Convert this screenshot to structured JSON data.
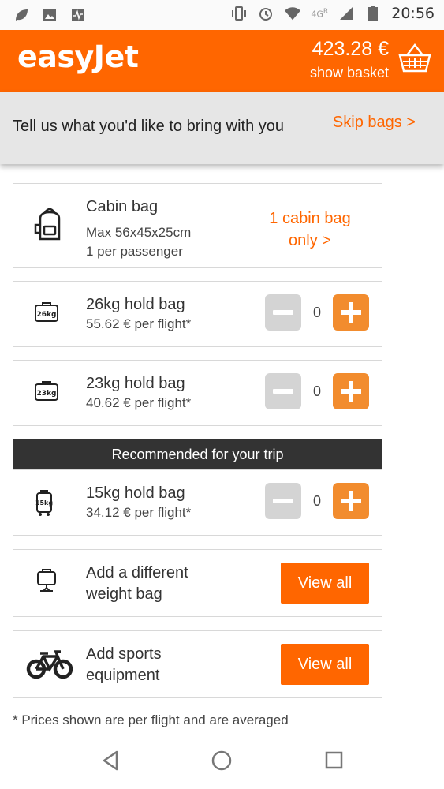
{
  "status_bar": {
    "network": "4G",
    "roaming": "R",
    "time": "20:56",
    "icons": [
      "leaf-icon",
      "image-icon",
      "activity-icon",
      "vibrate-icon",
      "alarm-icon",
      "wifi-icon",
      "signal-icon",
      "battery-icon"
    ]
  },
  "header": {
    "logo": "easyJet",
    "price": "423.28 €",
    "basket_label": "show basket",
    "brand_color": "#ff6600"
  },
  "subheader": {
    "title": "Tell us what you'd like to bring with you",
    "skip": "Skip bags >"
  },
  "cabin": {
    "title": "Cabin bag",
    "size": "Max 56x45x25cm",
    "limit": "1 per passenger",
    "link": "1 cabin bag only >"
  },
  "hold_bags": [
    {
      "title": "26kg hold bag",
      "price": "55.62 € per flight*",
      "qty": "0",
      "icon_label": "26kg"
    },
    {
      "title": "23kg hold bag",
      "price": "40.62 € per flight*",
      "qty": "0",
      "icon_label": "23kg"
    }
  ],
  "recommended": {
    "label": "Recommended for your trip",
    "bag": {
      "title": "15kg hold bag",
      "price": "34.12 € per flight*",
      "qty": "0",
      "icon_label": "15kg"
    }
  },
  "different_weight": {
    "title": "Add a different weight bag",
    "button": "View all"
  },
  "sports": {
    "title": "Add sports equipment",
    "button": "View all"
  },
  "footnote": "* Prices shown are per flight and are averaged"
}
